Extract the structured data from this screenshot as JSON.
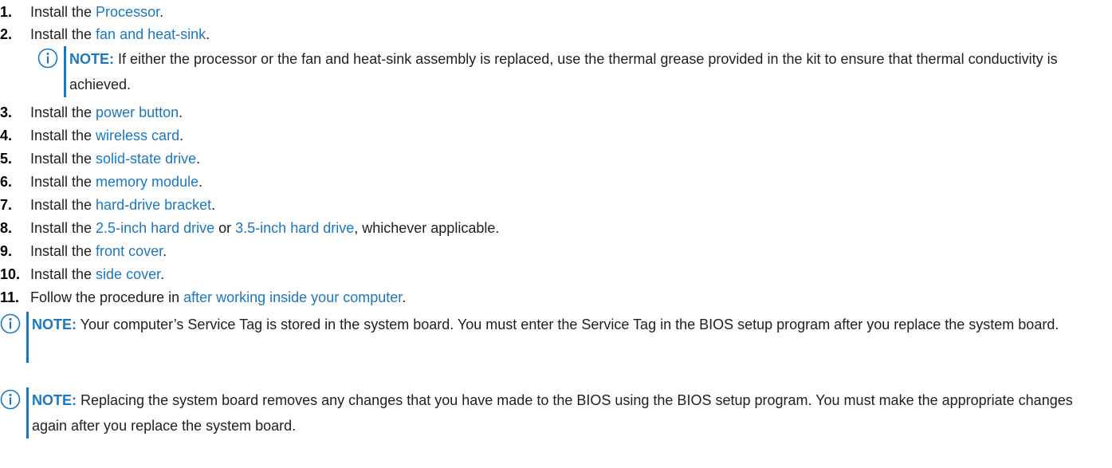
{
  "steps": [
    {
      "num": "1.",
      "pre": "Install the ",
      "link": "Processor",
      "post": "."
    },
    {
      "num": "2.",
      "pre": "Install the ",
      "link": "fan and heat-sink",
      "post": "."
    },
    {
      "num": "3.",
      "pre": "Install the ",
      "link": "power button",
      "post": "."
    },
    {
      "num": "4.",
      "pre": "Install the ",
      "link": "wireless card",
      "post": "."
    },
    {
      "num": "5.",
      "pre": "Install the ",
      "link": "solid-state drive",
      "post": "."
    },
    {
      "num": "6.",
      "pre": "Install the ",
      "link": "memory module",
      "post": "."
    },
    {
      "num": "7.",
      "pre": "Install the ",
      "link": "hard-drive bracket",
      "post": "."
    },
    {
      "num": "8.",
      "pre": "Install the ",
      "link": "2.5-inch hard drive",
      "mid": " or ",
      "link2": "3.5-inch hard drive",
      "post": ", whichever applicable."
    },
    {
      "num": "9.",
      "pre": "Install the ",
      "link": "front cover",
      "post": "."
    },
    {
      "num": "10.",
      "pre": "Install the ",
      "link": "side cover",
      "post": "."
    },
    {
      "num": "11.",
      "pre": "Follow the procedure in ",
      "link": "after working inside your computer",
      "post": "."
    }
  ],
  "notes": {
    "thermal": {
      "label": "NOTE:",
      "text": " If either the processor or the fan and heat-sink assembly is replaced, use the thermal grease provided in the kit to ensure that thermal conductivity is achieved."
    },
    "service_tag": {
      "label": "NOTE:",
      "text": " Your computer’s Service Tag is stored in the system board. You must enter the Service Tag in the BIOS setup program after you replace the system board."
    },
    "bios": {
      "label": "NOTE:",
      "text": " Replacing the system board removes any changes that you have made to the BIOS using the BIOS setup program. You must make the appropriate changes again after you replace the system board."
    }
  },
  "colors": {
    "link": "#1a78c2",
    "note_label": "#1a78c2",
    "note_bar": "#1a78c2"
  },
  "icons": {
    "note": "info-circle-icon"
  }
}
